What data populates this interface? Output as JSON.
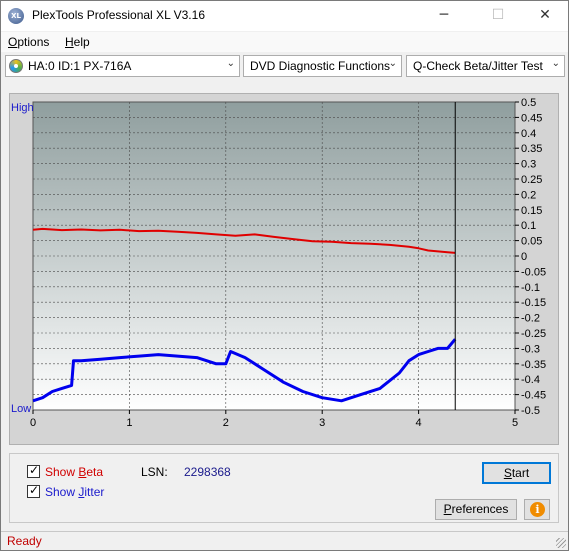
{
  "window": {
    "title": "PlexTools Professional XL V3.16",
    "app_icon_text": "XL",
    "minimize_glyph": "─",
    "maximize_glyph": "☐",
    "close_glyph": "✕"
  },
  "menu": {
    "options": {
      "accel": "O",
      "rest": "ptions"
    },
    "help": {
      "accel": "H",
      "rest": "elp"
    }
  },
  "toolbar": {
    "drive": "HA:0 ID:1  PX-716A",
    "function": "DVD Diagnostic Functions",
    "test": "Q-Check Beta/Jitter Test",
    "dropdown_glyph": "⌄"
  },
  "chart_data": {
    "type": "line",
    "left_axis_labels": {
      "high": "High",
      "low": "Low"
    },
    "x_ticks": [
      "0",
      "1",
      "2",
      "3",
      "4",
      "5"
    ],
    "xlim": [
      0,
      5
    ],
    "y_right_ticks": [
      "0.5",
      "0.45",
      "0.4",
      "0.35",
      "0.3",
      "0.25",
      "0.2",
      "0.15",
      "0.1",
      "0.05",
      "0",
      "-0.05",
      "-0.1",
      "-0.15",
      "-0.2",
      "-0.25",
      "-0.3",
      "-0.35",
      "-0.4",
      "-0.45",
      "-0.5"
    ],
    "ylim": [
      -0.5,
      0.5
    ],
    "grid": true,
    "end_marker_x": 4.38,
    "series": [
      {
        "color": "#e00000",
        "x": [
          0,
          0.1,
          0.3,
          0.5,
          0.7,
          0.9,
          1.1,
          1.3,
          1.5,
          1.7,
          1.9,
          2.1,
          2.3,
          2.5,
          2.7,
          2.9,
          3.1,
          3.3,
          3.5,
          3.7,
          3.9,
          4.0,
          4.1,
          4.2,
          4.3,
          4.38
        ],
        "y": [
          0.085,
          0.088,
          0.084,
          0.086,
          0.083,
          0.085,
          0.081,
          0.082,
          0.079,
          0.075,
          0.07,
          0.066,
          0.07,
          0.062,
          0.055,
          0.048,
          0.046,
          0.042,
          0.04,
          0.036,
          0.03,
          0.025,
          0.018,
          0.015,
          0.012,
          0.01
        ]
      },
      {
        "color": "#0000ee",
        "x": [
          0,
          0.1,
          0.2,
          0.3,
          0.4,
          0.42,
          0.5,
          0.7,
          0.9,
          1.1,
          1.3,
          1.5,
          1.7,
          1.9,
          2.0,
          2.05,
          2.2,
          2.4,
          2.6,
          2.8,
          3.0,
          3.2,
          3.4,
          3.6,
          3.8,
          3.9,
          4.0,
          4.1,
          4.2,
          4.3,
          4.38
        ],
        "y": [
          -0.47,
          -0.46,
          -0.44,
          -0.43,
          -0.42,
          -0.34,
          -0.34,
          -0.335,
          -0.33,
          -0.325,
          -0.32,
          -0.325,
          -0.33,
          -0.35,
          -0.35,
          -0.31,
          -0.33,
          -0.37,
          -0.41,
          -0.44,
          -0.46,
          -0.47,
          -0.45,
          -0.43,
          -0.38,
          -0.34,
          -0.32,
          -0.31,
          -0.3,
          -0.3,
          -0.27
        ]
      }
    ]
  },
  "controls": {
    "show_beta": {
      "prefix": "Show ",
      "accel": "B",
      "rest": "eta",
      "checked": true
    },
    "show_jitter": {
      "prefix": "Show ",
      "accel": "J",
      "rest": "itter",
      "checked": true
    },
    "lsn_label": "LSN:",
    "lsn_value": "2298368",
    "start": {
      "accel": "S",
      "rest": "tart"
    },
    "preferences": {
      "accel": "P",
      "rest": "references"
    },
    "info_glyph": "i"
  },
  "status": {
    "text": "Ready"
  }
}
